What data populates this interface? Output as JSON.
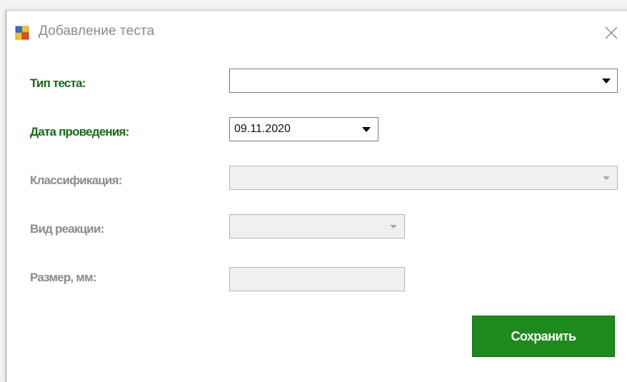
{
  "window": {
    "title": "Добавление теста",
    "icon": "form-app-icon",
    "close_icon": "close-icon"
  },
  "form": {
    "test_type": {
      "label": "Тип теста:",
      "value": "",
      "enabled": true
    },
    "date": {
      "label": "Дата проведения:",
      "value": "09.11.2020",
      "enabled": true
    },
    "classification": {
      "label": "Классификация:",
      "value": "",
      "enabled": false
    },
    "reaction_type": {
      "label": "Вид реакции:",
      "value": "",
      "enabled": false
    },
    "size": {
      "label": "Размер, мм:",
      "value": "",
      "enabled": false
    }
  },
  "actions": {
    "save_label": "Сохранить"
  },
  "colors": {
    "active_label": "#146e14",
    "disabled_label": "#8c8c8c",
    "save_button": "#1e8a1e"
  }
}
